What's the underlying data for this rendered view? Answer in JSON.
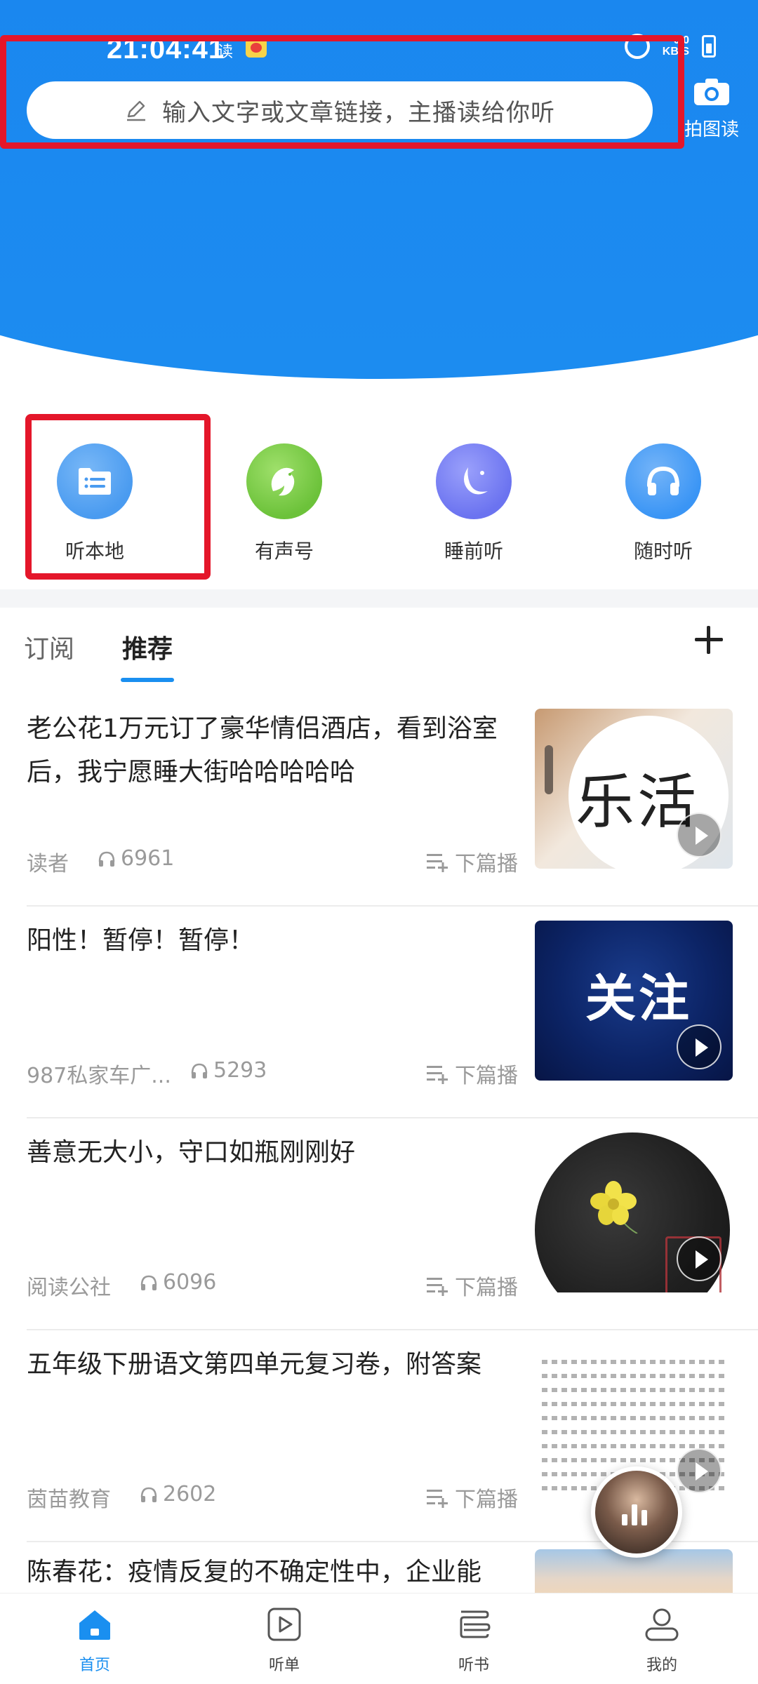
{
  "status_bar": {
    "time": "21:04:41",
    "note": "读",
    "net_speed": "0.0",
    "net_unit": "KB/S"
  },
  "search": {
    "placeholder": "输入文字或文章链接，主播读给你听"
  },
  "camera": {
    "label": "拍图读"
  },
  "quick_menu": [
    {
      "label": "听本地",
      "icon": "folder-list-icon",
      "color": "#4a9bf0"
    },
    {
      "label": "有声号",
      "icon": "dolphin-icon",
      "color": "#6cc23a"
    },
    {
      "label": "睡前听",
      "icon": "moon-icon",
      "color": "#6b73f0"
    },
    {
      "label": "随时听",
      "icon": "headphones-icon",
      "color": "#3a95f5"
    }
  ],
  "tabs": {
    "subscribe": "订阅",
    "recommend": "推荐",
    "active": "推荐"
  },
  "feed": [
    {
      "title": "老公花1万元订了豪华情侣酒店，看到浴室后，我宁愿睡大街哈哈哈哈哈",
      "source": "读者",
      "count": "6961",
      "action": "下篇播",
      "thumb_text": "乐活"
    },
    {
      "title": "阳性！暂停！暂停！",
      "source": "987私家车广...",
      "count": "5293",
      "action": "下篇播",
      "thumb_text": "关注"
    },
    {
      "title": "善意无大小，守口如瓶刚刚好",
      "source": "阅读公社",
      "count": "6096",
      "action": "下篇播"
    },
    {
      "title": "五年级下册语文第四单元复习卷，附答案",
      "source": "茵苗教育",
      "count": "2602",
      "action": "下篇播"
    },
    {
      "title": "陈春花：疫情反复的不确定性中，企业能"
    }
  ],
  "bottom_nav": [
    {
      "label": "首页",
      "icon": "home-icon",
      "active": true
    },
    {
      "label": "听单",
      "icon": "playlist-icon",
      "active": false
    },
    {
      "label": "听书",
      "icon": "book-icon",
      "active": false
    },
    {
      "label": "我的",
      "icon": "profile-icon",
      "active": false
    }
  ],
  "colors": {
    "header_blue": "#1a86ef",
    "accent": "#1a8ff0",
    "highlight_red": "#e4162a"
  }
}
